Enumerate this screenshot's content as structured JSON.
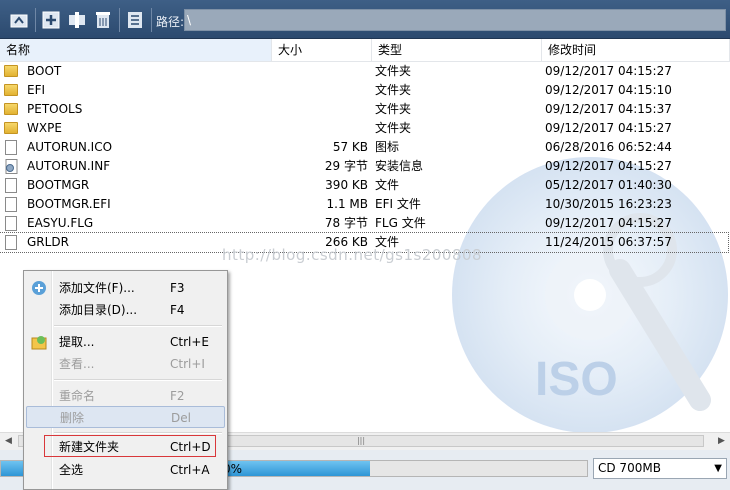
{
  "toolbar": {
    "path_label": "路径:",
    "path_value": "\\",
    "buttons": [
      "up-folder-icon",
      "add-icon",
      "extract-icon",
      "delete-icon",
      "properties-icon"
    ]
  },
  "columns": {
    "name": "名称",
    "size": "大小",
    "type": "类型",
    "modified": "修改时间"
  },
  "files": [
    {
      "name": "BOOT",
      "size": "",
      "type": "文件夹",
      "date": "09/12/2017 04:15:27",
      "kind": "folder"
    },
    {
      "name": "EFI",
      "size": "",
      "type": "文件夹",
      "date": "09/12/2017 04:15:10",
      "kind": "folder"
    },
    {
      "name": "PETOOLS",
      "size": "",
      "type": "文件夹",
      "date": "09/12/2017 04:15:37",
      "kind": "folder"
    },
    {
      "name": "WXPE",
      "size": "",
      "type": "文件夹",
      "date": "09/12/2017 04:15:27",
      "kind": "folder"
    },
    {
      "name": "AUTORUN.ICO",
      "size": "57 KB",
      "type": "图标",
      "date": "06/28/2016 06:52:44",
      "kind": "file"
    },
    {
      "name": "AUTORUN.INF",
      "size": "29 字节",
      "type": "安装信息",
      "date": "09/12/2017 04:15:27",
      "kind": "file"
    },
    {
      "name": "BOOTMGR",
      "size": "390 KB",
      "type": "文件",
      "date": "05/12/2017 01:40:30",
      "kind": "file"
    },
    {
      "name": "BOOTMGR.EFI",
      "size": "1.1 MB",
      "type": "EFI 文件",
      "date": "10/30/2015 16:23:23",
      "kind": "file"
    },
    {
      "name": "EASYU.FLG",
      "size": "78 字节",
      "type": "FLG 文件",
      "date": "09/12/2017 04:15:27",
      "kind": "file"
    },
    {
      "name": "GRLDR",
      "size": "266 KB",
      "type": "文件",
      "date": "11/24/2015 06:37:57",
      "kind": "file"
    }
  ],
  "watermark": "http://blog.csdn.net/gs1s200808",
  "menu": {
    "add_file": {
      "label": "添加文件(F)...",
      "key": "F3"
    },
    "add_dir": {
      "label": "添加目录(D)...",
      "key": "F4"
    },
    "extract": {
      "label": "提取...",
      "key": "Ctrl+E"
    },
    "view": {
      "label": "查看...",
      "key": "Ctrl+I"
    },
    "rename": {
      "label": "重命名",
      "key": "F2"
    },
    "delete": {
      "label": "删除",
      "key": "Del"
    },
    "new_folder": {
      "label": "新建文件夹",
      "key": "Ctrl+D"
    },
    "select_all": {
      "label": "全选",
      "key": "Ctrl+A"
    }
  },
  "status": {
    "progress_text": "0%",
    "progress_fraction": 0.63,
    "media": "CD 700MB"
  },
  "colors": {
    "accent": "#2e95d6",
    "toolbar": "#2c4a6f",
    "focus_border": "#d9373a"
  }
}
